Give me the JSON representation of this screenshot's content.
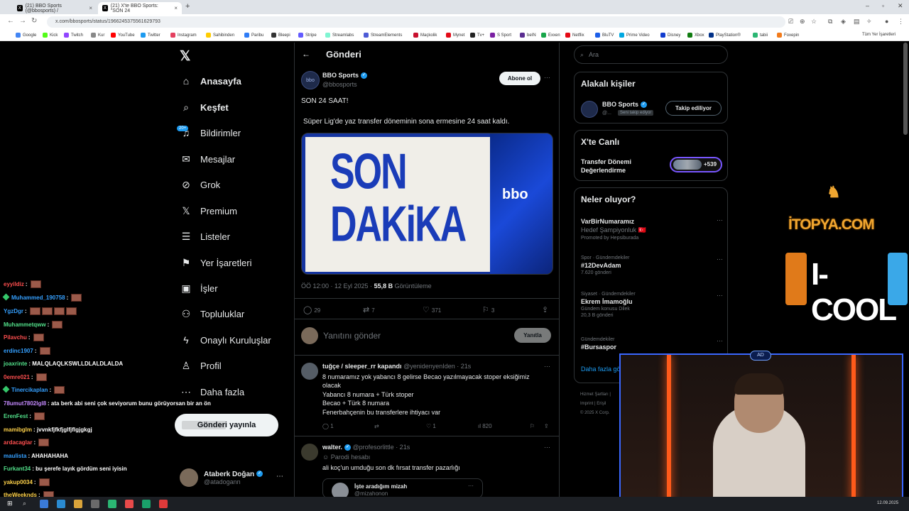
{
  "browser": {
    "tabs": [
      {
        "label": "(21) BBO Sports (@bbosports) /",
        "active": false
      },
      {
        "label": "(21) X'te BBO Sports: \"SON 24",
        "active": true
      }
    ],
    "url": "x.com/bbosports/status/1966245375561629793",
    "bookmarks": [
      "Google",
      "Kick",
      "Twitch",
      "Kur",
      "YouTube",
      "Twitter",
      "Instagram",
      "Sahibinden",
      "Paribu",
      "Bleepi",
      "Stripe",
      "Streamlabs",
      "StreamElements",
      "Maçkolik",
      "Mynet",
      "Tv+",
      "S Sport",
      "beIN",
      "Exxen",
      "Netflix",
      "BluTV",
      "Prime Video",
      "Disney",
      "Xbox",
      "PlayStation®",
      "tabii",
      "Foxepin"
    ],
    "other_bookmarks": "Tüm Yer İşaretleri"
  },
  "nav": {
    "items": [
      {
        "label": "Anasayfa",
        "icon": "home-icon",
        "glyph": "⌂",
        "bold": true
      },
      {
        "label": "Keşfet",
        "icon": "search-icon",
        "glyph": "⌕",
        "bold": true
      },
      {
        "label": "Bildirimler",
        "icon": "bell-icon",
        "glyph": "♫",
        "bold": false
      },
      {
        "label": "Mesajlar",
        "icon": "mail-icon",
        "glyph": "✉",
        "bold": false
      },
      {
        "label": "Grok",
        "icon": "grok-icon",
        "glyph": "⊘",
        "bold": false
      },
      {
        "label": "Premium",
        "icon": "x-premium-icon",
        "glyph": "𝕏",
        "bold": false
      },
      {
        "label": "Listeler",
        "icon": "list-icon",
        "glyph": "☰",
        "bold": false
      },
      {
        "label": "Yer İşaretleri",
        "icon": "bookmark-icon",
        "glyph": "⚑",
        "bold": false
      },
      {
        "label": "İşler",
        "icon": "briefcase-icon",
        "glyph": "▣",
        "bold": false
      },
      {
        "label": "Topluluklar",
        "icon": "people-icon",
        "glyph": "⚇",
        "bold": false
      },
      {
        "label": "Onaylı Kuruluşlar",
        "icon": "lightning-icon",
        "glyph": "ϟ",
        "bold": false
      },
      {
        "label": "Profil",
        "icon": "person-icon",
        "glyph": "♙",
        "bold": false
      },
      {
        "label": "Daha fazla",
        "icon": "more-icon",
        "glyph": "⋯",
        "bold": false
      }
    ],
    "notif_badge": "20+",
    "post_button": "Gönderi yayınla",
    "account": {
      "name": "Ataberk Doğan",
      "handle": "@atadogann"
    }
  },
  "main": {
    "title": "Gönderi",
    "author_name": "BBO Sports",
    "author_handle": "@bbosports",
    "subscribe": "Abone ol",
    "text1": "SON 24 SAAT!",
    "text2": "Süper Lig'de yaz transfer döneminin sona ermesine 24 saat kaldı.",
    "image_words": [
      "SON",
      "DAKiKA"
    ],
    "image_logo": "bbo",
    "meta_time": "ÖÖ 12:00 · 12 Eyl 2025 · ",
    "meta_views": "55,8 B",
    "meta_views_label": " Görüntüleme",
    "actions": {
      "reply": "29",
      "retweet": "7",
      "like": "371",
      "bookmark": "3"
    },
    "reply_placeholder": "Yanıtını gönder",
    "reply_button": "Yanıtla",
    "replies": [
      {
        "name": "tuğçe / sleeper_rr kapandı",
        "handle": "@yenidenyenIden · 21s",
        "lines": [
          "8 numaramız yok yabancı 8 gelirse Becao yazılmayacak stoper eksiğimiz",
          "olacak",
          "Yabancı 8 numara + Türk stoper",
          "Becao + Türk 8 numara",
          "Fenerbahçenin bu transferlere ihtiyacı var"
        ],
        "replies": "1",
        "likes": "1",
        "views": "820"
      },
      {
        "name": "walter.",
        "handle": "@profesorlittle · 21s",
        "badge": "Parodi hesabı",
        "lines": [
          "ali koç'un umduğu son dk fırsat transfer pazarlığı"
        ],
        "quote_title": "İşte aradığım mizah",
        "quote_handle": "@mizahonon"
      }
    ]
  },
  "right": {
    "search_placeholder": "Ara",
    "related_title": "Alakalı kişiler",
    "related_name": "BBO Sports",
    "related_handle": "@...",
    "related_follows": "Seni takip ediyor",
    "follow_button": "Takip ediliyor",
    "live_title_heading": "X'te Canlı",
    "live_title": "Transfer Dönemi Değerlendirme",
    "live_count": "+539",
    "trends_title": "Neler oluyor?",
    "trends": [
      {
        "cat": "",
        "ttl": "VarBirNumaramız",
        "sub": "Hedef Şampiyonluk 🇹🇷",
        "promo": "Promoted by Hepsiburada"
      },
      {
        "cat": "Spor · Gündemdekiler",
        "ttl": "#12DevAdam",
        "sub": "7.620 gönderi"
      },
      {
        "cat": "Siyaset · Gündemdekiler",
        "ttl": "Ekrem İmamoğlu",
        "sub": "Gündem konusu Dilek",
        "sub2": "20,3 B gönderi"
      },
      {
        "cat": "Gündemdekiler",
        "ttl": "#Bursaspor",
        "sub": ""
      }
    ],
    "show_more": "Daha fazla gö",
    "footer": [
      "Hizmet Şartları |",
      "Imprint | Erişil",
      "© 2025 X Corp."
    ]
  },
  "overlays": {
    "itopya": "İTOPYA.COM",
    "icool": "I-COOL",
    "cam_logo": "AD"
  },
  "chat": [
    {
      "user": "eyyildiz",
      "color": "#ff4f4f",
      "msg": "",
      "emotes": 1
    },
    {
      "user": "Muhammed_190758",
      "color": "#35a0ff",
      "msg": "",
      "emotes": 1,
      "badge": true
    },
    {
      "user": "YgzDgr",
      "color": "#35a0ff",
      "msg": "",
      "emotes": 4
    },
    {
      "user": "Muhammetqww",
      "color": "#52e08a",
      "msg": "",
      "emotes": 1
    },
    {
      "user": "Pilavchu",
      "color": "#ff4f4f",
      "msg": "",
      "emotes": 1
    },
    {
      "user": "erdinc1907",
      "color": "#35a0ff",
      "msg": "",
      "emotes": 1
    },
    {
      "user": "joaxrinte",
      "color": "#52e08a",
      "msg": "MALQLAQLKSWLLDLALDLALDA",
      "emotes": 0
    },
    {
      "user": "0emre021",
      "color": "#ff4f4f",
      "msg": "",
      "emotes": 1
    },
    {
      "user": "Tinercikaplan",
      "color": "#35a0ff",
      "msg": "",
      "emotes": 1,
      "badge": true
    },
    {
      "user": "78umut7802lgl8",
      "color": "#c58aff",
      "msg": "ata berk abi seni çok seviyorum bunu görüyorsan bir an ön",
      "emotes": 0
    },
    {
      "user": "ErenFest",
      "color": "#52e08a",
      "msg": "",
      "emotes": 1
    },
    {
      "user": "mamibglm",
      "color": "#ffd24a",
      "msg": "jvvnkfjfkfjglfjflgjgkgj",
      "emotes": 0
    },
    {
      "user": "ardacaglar",
      "color": "#ff4f4f",
      "msg": "",
      "emotes": 1
    },
    {
      "user": "maulista",
      "color": "#35a0ff",
      "msg": "AHAHAHAHA",
      "emotes": 0
    },
    {
      "user": "Furkant34",
      "color": "#52e08a",
      "msg": "bu şerefe layık gördüm seni iyisin",
      "emotes": 0
    },
    {
      "user": "yakup0034",
      "color": "#ffd24a",
      "msg": "",
      "emotes": 1
    },
    {
      "user": "theWeeknds",
      "color": "#ffd24a",
      "msg": "",
      "emotes": 1
    }
  ],
  "taskbar": {
    "clock": "12.09.2025"
  }
}
